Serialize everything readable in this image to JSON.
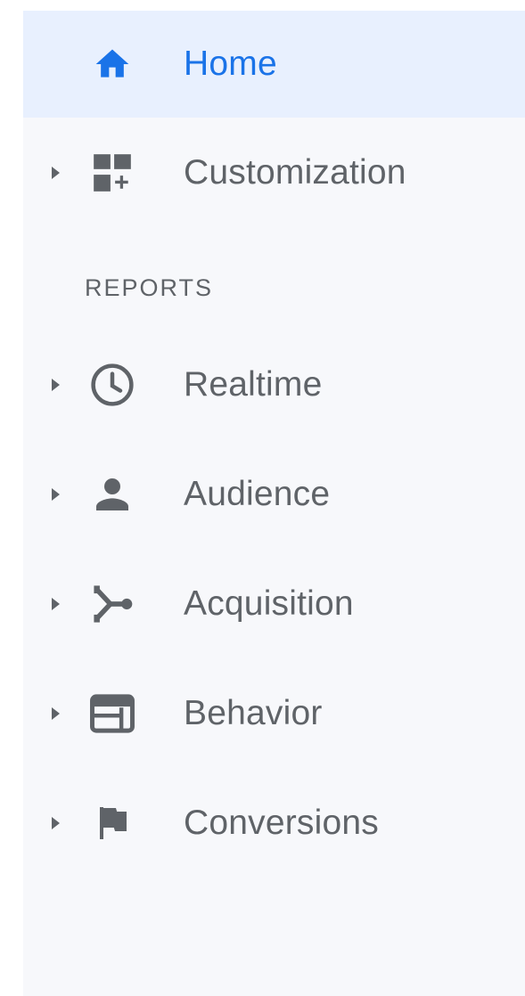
{
  "nav": {
    "home": {
      "label": "Home",
      "icon": "home-icon",
      "active": true
    },
    "customization": {
      "label": "Customization",
      "icon": "dashboard-add-icon",
      "expandable": true
    },
    "reports_header": "REPORTS",
    "reports": [
      {
        "label": "Realtime",
        "icon": "clock-icon",
        "expandable": true
      },
      {
        "label": "Audience",
        "icon": "person-icon",
        "expandable": true
      },
      {
        "label": "Acquisition",
        "icon": "merge-arrows-icon",
        "expandable": true
      },
      {
        "label": "Behavior",
        "icon": "web-layout-icon",
        "expandable": true
      },
      {
        "label": "Conversions",
        "icon": "flag-icon",
        "expandable": true
      }
    ]
  },
  "colors": {
    "accent": "#1a73e8",
    "active_bg": "#e8f0fe",
    "sidebar_bg": "#f7f8fb",
    "text": "#5f6368"
  }
}
